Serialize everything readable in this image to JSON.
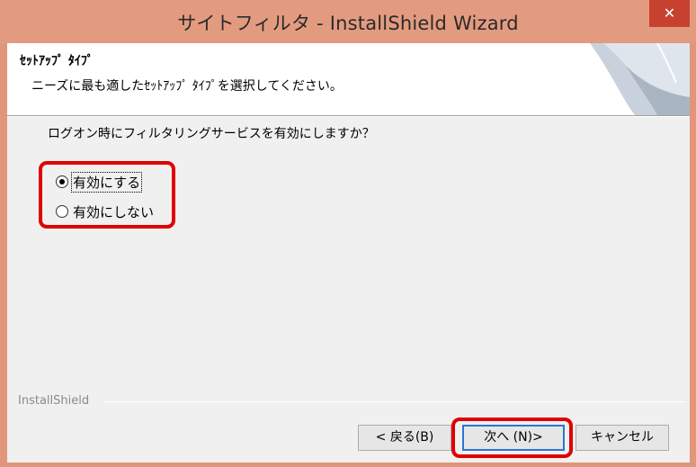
{
  "window": {
    "title": "サイトフィルタ - InstallShield Wizard",
    "close_glyph": "✕"
  },
  "header": {
    "title": "ｾｯﾄｱｯﾌﾟ ﾀｲﾌﾟ",
    "subtitle": "ニーズに最も適したｾｯﾄｱｯﾌﾟ ﾀｲﾌﾟを選択してください。"
  },
  "body": {
    "question": "ログオン時にフィルタリングサービスを有効にしますか？",
    "options": [
      {
        "label": "有効にする",
        "selected": true
      },
      {
        "label": "有効にしない",
        "selected": false
      }
    ]
  },
  "footer": {
    "brand": "InstallShield",
    "back_label": "< 戻る(B)",
    "next_label": "次へ (N)>",
    "cancel_label": "キャンセル"
  },
  "colors": {
    "frame": "#e39b80",
    "close": "#c7412f",
    "highlight": "#e00000",
    "focus": "#2a76d3"
  }
}
